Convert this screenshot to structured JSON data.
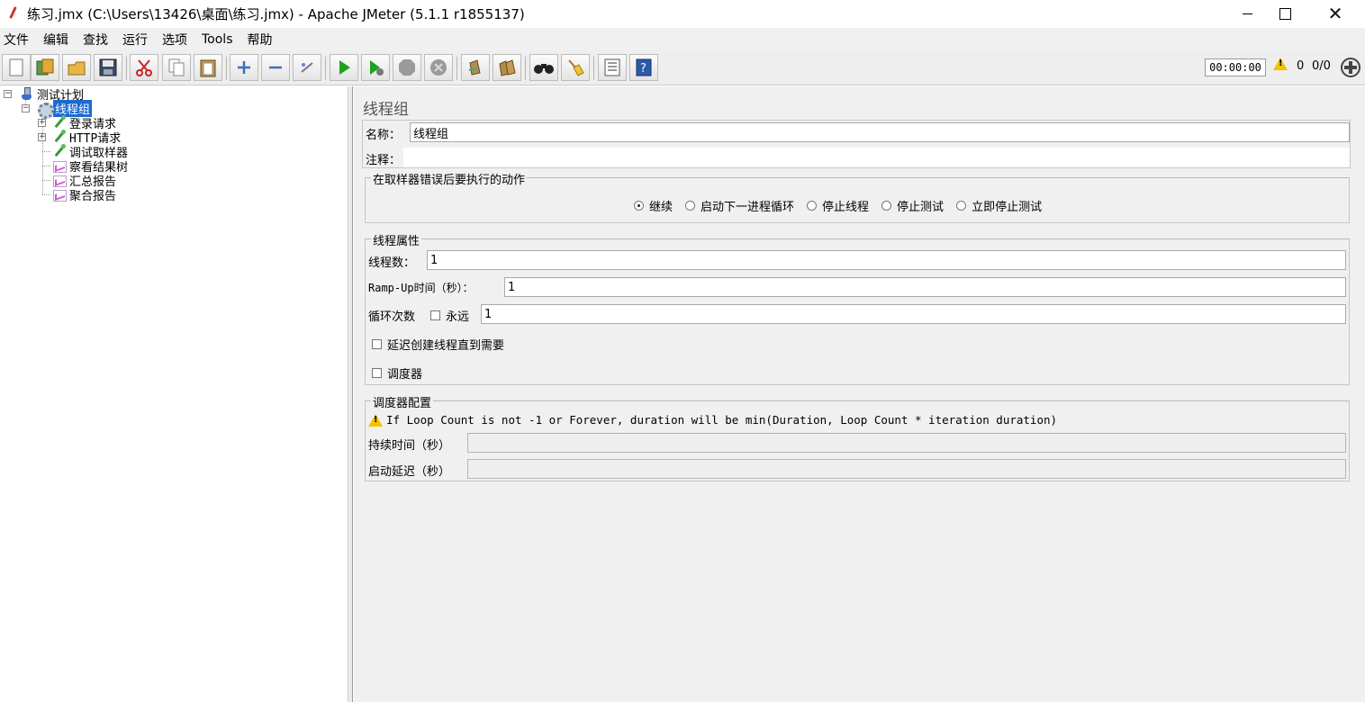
{
  "window": {
    "title": "练习.jmx (C:\\Users\\13426\\桌面\\练习.jmx) - Apache JMeter (5.1.1 r1855137)",
    "close_symbol": "✕"
  },
  "menu": [
    "文件",
    "编辑",
    "查找",
    "运行",
    "选项",
    "Tools",
    "帮助"
  ],
  "toolbar": {
    "buttons": [
      "new-icon",
      "templates-icon",
      "open-icon",
      "save-icon",
      "cut-icon",
      "copy-icon",
      "paste-icon",
      "expand-icon",
      "collapse-icon",
      "toggle-icon",
      "start-icon",
      "start-no-pause-icon",
      "stop-icon",
      "shutdown-icon",
      "clear-icon",
      "clear-all-icon",
      "search-icon",
      "reset-search-icon",
      "function-helper-icon",
      "help-icon"
    ],
    "timer": "00:00:00",
    "warning_count": "0",
    "thread_count": "0/0"
  },
  "tree": {
    "test_plan": "测试计划",
    "thread_group": "线程组",
    "children": [
      "登录请求",
      "HTTP请求",
      "调试取样器",
      "察看结果树",
      "汇总报告",
      "聚合报告"
    ]
  },
  "panel": {
    "title": "线程组",
    "name_label": "名称：",
    "name_value": "线程组",
    "comment_label": "注释：",
    "comment_value": "",
    "error_action": {
      "title": "在取样器错误后要执行的动作",
      "options": [
        "继续",
        "启动下一进程循环",
        "停止线程",
        "停止测试",
        "立即停止测试"
      ],
      "selected": "继续"
    },
    "thread_props": {
      "title": "线程属性",
      "threads_label": "线程数：",
      "threads_value": "1",
      "rampup_label": "Ramp-Up时间（秒）：",
      "rampup_value": "1",
      "loop_label": "循环次数",
      "forever_label": "永远",
      "loop_value": "1",
      "delay_label": "延迟创建线程直到需要",
      "scheduler_label": "调度器"
    },
    "scheduler": {
      "title": "调度器配置",
      "warning": "If Loop Count is not -1 or Forever, duration will be min(Duration, Loop Count * iteration duration)",
      "duration_label": "持续时间（秒）",
      "duration_value": "",
      "delay_label": "启动延迟（秒）",
      "delay_value": ""
    }
  }
}
